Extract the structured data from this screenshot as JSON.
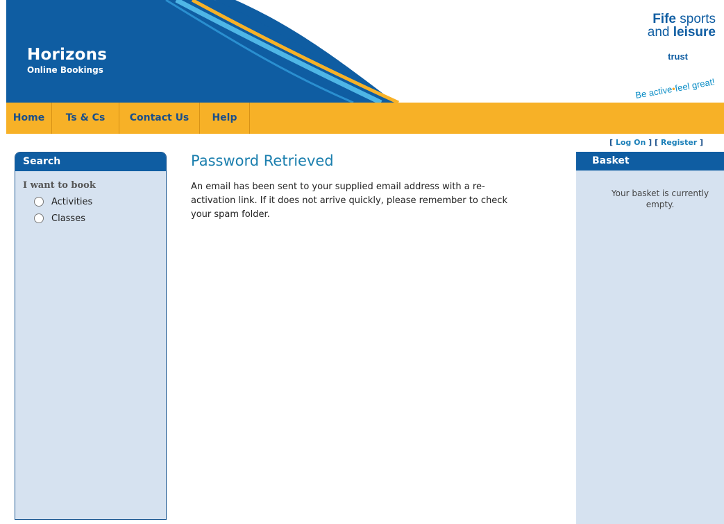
{
  "header": {
    "title": "Horizons",
    "subtitle": "Online Bookings",
    "logo": {
      "line1_bold": "Fife",
      "line1_rest": " sports",
      "line2_rest": "and ",
      "line2_bold": "leisure",
      "trust": "trust",
      "tagline_a": "Be active",
      "tagline_b": "feel great!"
    }
  },
  "nav": {
    "items": [
      {
        "label": "Home"
      },
      {
        "label": "Ts & Cs"
      },
      {
        "label": "Contact Us"
      },
      {
        "label": "Help"
      }
    ]
  },
  "search": {
    "title": "Search",
    "label": "I want to book",
    "options": [
      {
        "label": "Activities"
      },
      {
        "label": "Classes"
      }
    ]
  },
  "main": {
    "title": "Password Retrieved",
    "message_line1": "An email has been sent to your supplied email address with a re-",
    "message_line2": "activation link. If it does not arrive quickly, please remember to check",
    "message_line3": "your spam folder."
  },
  "account": {
    "open1": "[ ",
    "log_on": "Log On",
    "close1": " ] [ ",
    "register": "Register",
    "close2": " ]"
  },
  "basket": {
    "title": "Basket",
    "empty_line1": "Your basket is currently",
    "empty_line2": "empty."
  },
  "colors": {
    "brand_blue": "#0f5da2",
    "nav_orange": "#f7b127",
    "panel_bg": "#d6e2f0",
    "title_teal": "#1b7fae"
  }
}
